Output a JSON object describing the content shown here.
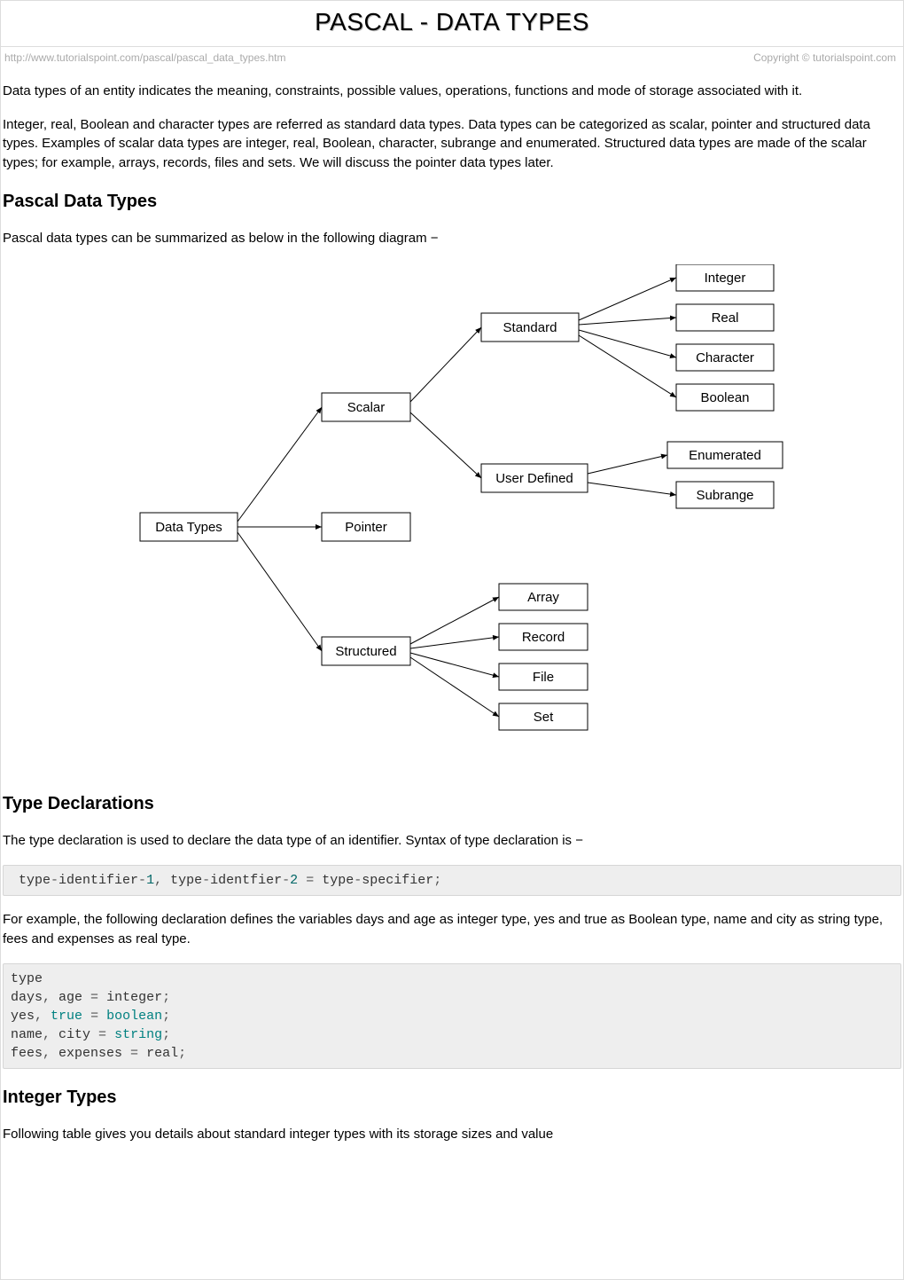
{
  "header": {
    "title": "PASCAL - DATA TYPES",
    "url": "http://www.tutorialspoint.com/pascal/pascal_data_types.htm",
    "copyright": "Copyright © tutorialspoint.com"
  },
  "intro": {
    "p1": "Data types of an entity indicates the meaning, constraints, possible values, operations, functions and mode of storage associated with it.",
    "p2": "Integer, real, Boolean and character types are referred as standard data types. Data types can be categorized as scalar, pointer and structured data types. Examples of scalar data types are integer, real, Boolean, character, subrange and enumerated. Structured data types are made of the scalar types; for example, arrays, records, files and sets. We will discuss the pointer data types later."
  },
  "section1": {
    "heading": "Pascal Data Types",
    "p1": "Pascal data types can be summarized as below in the following diagram −"
  },
  "diagram": {
    "root": "Data Types",
    "scalar": "Scalar",
    "pointer": "Pointer",
    "structured": "Structured",
    "standard": "Standard",
    "user_defined": "User Defined",
    "integer": "Integer",
    "real": "Real",
    "character": "Character",
    "boolean": "Boolean",
    "enumerated": "Enumerated",
    "subrange": "Subrange",
    "array": "Array",
    "record": "Record",
    "file": "File",
    "set": "Set"
  },
  "section2": {
    "heading": "Type Declarations",
    "p1": "The type declaration is used to declare the data type of an identifier. Syntax of type declaration is −",
    "p2": "For example, the following declaration defines the variables days and age as integer type, yes and true as Boolean type, name and city as string type, fees and expenses as real type."
  },
  "code1": {
    "t1": " type",
    "t2": "identifier",
    "n1": "1",
    "t3": " type",
    "t4": "identfier",
    "n2": "2",
    "t5": " type",
    "t6": "specifier",
    "dash": "-",
    "comma": ",",
    "eq": "=",
    "semi": ";"
  },
  "code2": {
    "l1a": "type",
    "l2a": "days",
    "l2b": " age ",
    "l2c": " integer",
    "l3a": "yes",
    "l3b": "true",
    "l3c": "boolean",
    "l4a": "name",
    "l4b": " city ",
    "l4c": "string",
    "l5a": "fees",
    "l5b": " expenses ",
    "l5c": " real",
    "comma": ",",
    "eq": "=",
    "semi": ";",
    "sp": " "
  },
  "section3": {
    "heading": "Integer Types",
    "p1": "Following table gives you details about standard integer types with its storage sizes and value"
  }
}
